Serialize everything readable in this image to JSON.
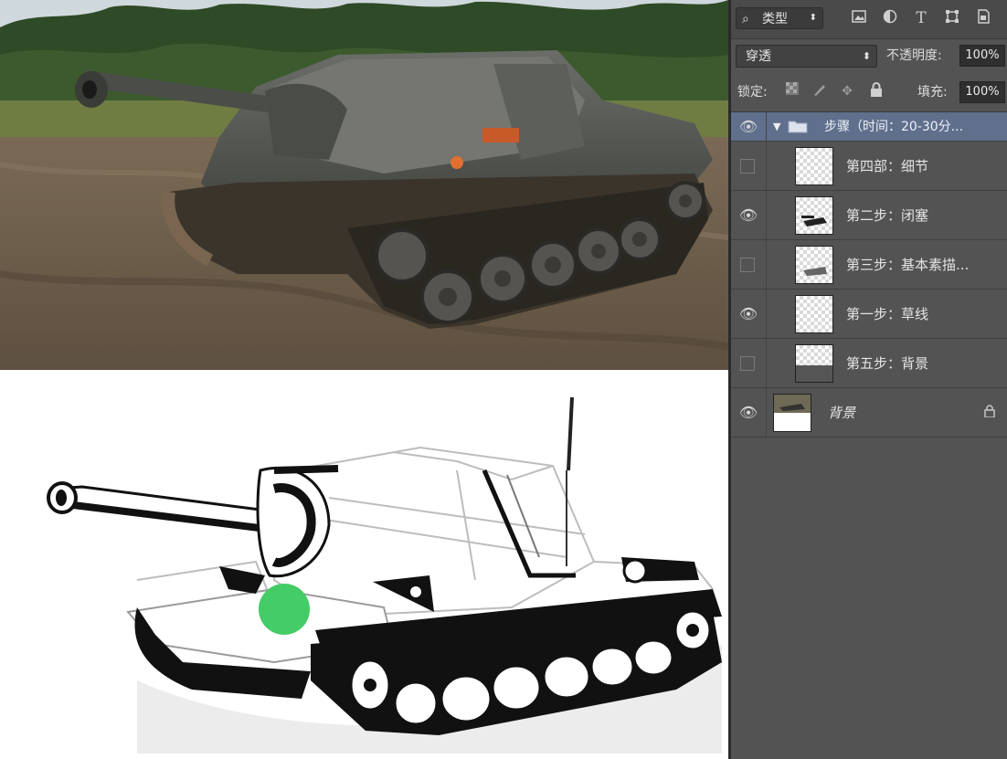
{
  "app": "Photoshop",
  "colors": {
    "panel_bg": "#535353",
    "selected_group": "#5f6f8c",
    "sketch_dot": "#44cc66"
  },
  "canvas": {
    "reference_photo": "tank-photo",
    "sketch": "tank-line-sketch"
  },
  "layers_panel": {
    "filter": {
      "icon": "search-icon",
      "label": "类型"
    },
    "filter_icons": [
      "image-filter-icon",
      "adjustment-filter-icon",
      "type-filter-icon",
      "shape-filter-icon",
      "smart-object-filter-icon"
    ],
    "blend_mode": "穿透",
    "opacity_label": "不透明度:",
    "opacity_value": "100%",
    "lock_label": "锁定:",
    "lock_icons": [
      "lock-transparent-icon",
      "lock-image-icon",
      "lock-position-icon",
      "lock-all-icon"
    ],
    "fill_label": "填充:",
    "fill_value": "100%",
    "group": {
      "name": "步骤（时间：20-30分...",
      "visible": true,
      "expanded": true
    },
    "layers": [
      {
        "name": "第四部：细节",
        "visible": false
      },
      {
        "name": "第二步：闭塞",
        "visible": true
      },
      {
        "name": "第三步：基本素描...",
        "visible": false
      },
      {
        "name": "第一步：草线",
        "visible": true
      },
      {
        "name": "第五步：背景",
        "visible": false
      }
    ],
    "background_layer": {
      "name": "背景",
      "visible": true,
      "locked": true
    }
  }
}
